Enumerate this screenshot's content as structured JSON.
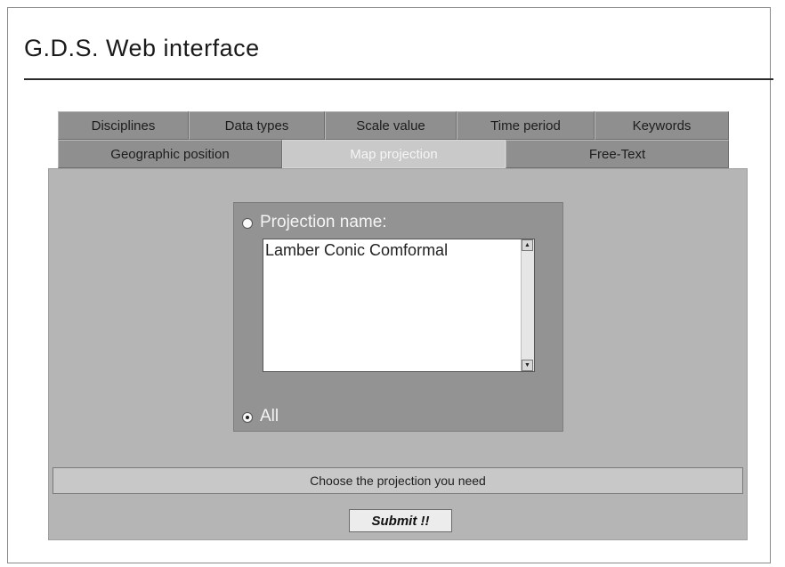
{
  "page": {
    "title": "G.D.S. Web interface"
  },
  "tabs": {
    "row1": [
      {
        "label": "Disciplines"
      },
      {
        "label": "Data types"
      },
      {
        "label": "Scale value"
      },
      {
        "label": "Time period"
      },
      {
        "label": "Keywords"
      }
    ],
    "row2": [
      {
        "label": "Geographic position"
      },
      {
        "label": "Map projection",
        "active": true
      },
      {
        "label": "Free-Text"
      }
    ]
  },
  "form": {
    "projection_radio_label": "Projection name:",
    "projection_selected": false,
    "projection_options": [
      "Lamber Conic Comformal"
    ],
    "all_radio_label": "All",
    "all_selected": true
  },
  "status_text": "Choose the projection you need",
  "submit_label": "Submit !!",
  "colors": {
    "tab": "#8f8f8f",
    "active_tab": "#c9c9c9",
    "panel": "#b5b5b5",
    "inner_panel": "#939393"
  }
}
